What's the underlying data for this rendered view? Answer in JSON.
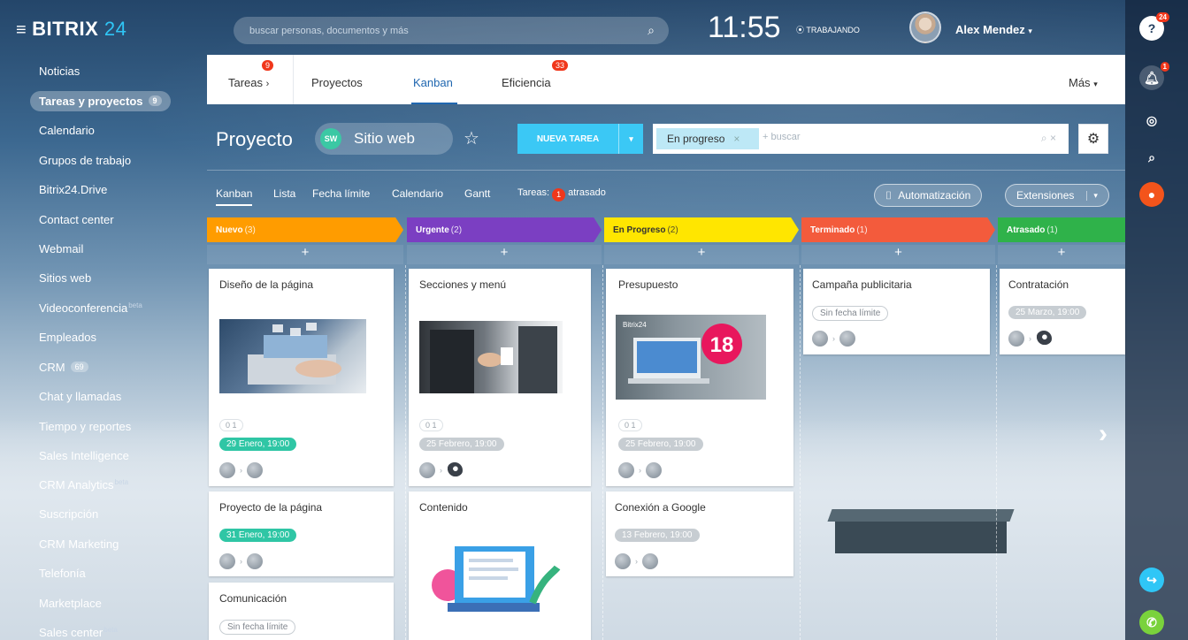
{
  "topbar": {
    "logo_main": "BITRIX",
    "logo_24": " 24",
    "search_placeholder": "buscar personas, documentos y más",
    "clock": "11:55",
    "work_status": "⦿ TRABAJANDO",
    "user_name": "Alex Mendez"
  },
  "right_panel": {
    "help_badge": "24",
    "notifications_badge": "1"
  },
  "sidebar": {
    "items": [
      {
        "label": "Noticias"
      },
      {
        "label": "Tareas y proyectos",
        "count": "9"
      },
      {
        "label": "Calendario"
      },
      {
        "label": "Grupos de trabajo"
      },
      {
        "label": "Bitrix24.Drive"
      },
      {
        "label": "Contact center"
      },
      {
        "label": "Webmail"
      },
      {
        "label": "Sitios web"
      },
      {
        "label": "Videoconferencia",
        "beta": "beta"
      },
      {
        "label": "Empleados"
      },
      {
        "label": "CRM",
        "count": "69"
      },
      {
        "label": "Chat y llamadas"
      },
      {
        "label": "Tiempo y reportes"
      },
      {
        "label": "Sales Intelligence"
      },
      {
        "label": "CRM Analytics",
        "beta": "beta"
      },
      {
        "label": "Suscripción"
      },
      {
        "label": "CRM Marketing"
      },
      {
        "label": "Telefonía"
      },
      {
        "label": "Marketplace"
      },
      {
        "label": "Sales center",
        "beta": "beta"
      }
    ]
  },
  "tabs": {
    "tareas": "Tareas",
    "tareas_badge": "9",
    "proyectos": "Proyectos",
    "kanban": "Kanban",
    "eficiencia": "Eficiencia",
    "eficiencia_badge": "33",
    "mas": "Más"
  },
  "project": {
    "title": "Proyecto",
    "name": "Sitio web",
    "new_task": "NUEVA TAREA",
    "filter_chip": "En progreso",
    "filter_placeholder": "+ buscar"
  },
  "views": {
    "kanban": "Kanban",
    "lista": "Lista",
    "fecha": "Fecha límite",
    "calendario": "Calendario",
    "gantt": "Gantt",
    "tareas_label": "Tareas:",
    "overdue_count": "1",
    "overdue_label": "atrasado",
    "automation": "Automatización",
    "extensions": "Extensiones"
  },
  "columns": [
    {
      "name": "Nuevo",
      "count": "(3)",
      "color": "#ff9c00"
    },
    {
      "name": "Urgente",
      "count": "(2)",
      "color": "#7b3fc2"
    },
    {
      "name": "En Progreso",
      "count": "(2)",
      "color": "#ffe600"
    },
    {
      "name": "Terminado",
      "count": "(1)",
      "color": "#f35b3c"
    },
    {
      "name": "Atrasado",
      "count": "(1)",
      "color": "#2fb24a"
    }
  ],
  "cards": {
    "c1": {
      "title": "Diseño de la página",
      "checklist": "0 1",
      "deadline": "29 Enero, 19:00"
    },
    "c2": {
      "title": "Proyecto de la página",
      "deadline": "31 Enero, 19:00"
    },
    "c3": {
      "title": "Comunicación",
      "deadline": "Sin fecha límite"
    },
    "c4": {
      "title": "Secciones y menú",
      "checklist": "0 1",
      "deadline": "25 Febrero, 19:00"
    },
    "c5": {
      "title": "Contenido"
    },
    "c6": {
      "title": "Presupuesto",
      "checklist": "0 1",
      "deadline": "25 Febrero, 19:00",
      "thumb_brand": "Bitrix24",
      "thumb_number": "18"
    },
    "c7": {
      "title": "Conexión a Google",
      "deadline": "13 Febrero, 19:00"
    },
    "c8": {
      "title": "Campaña publicitaria",
      "deadline": "Sin fecha límite"
    },
    "c9": {
      "title": "Contratación",
      "deadline": "25 Marzo, 19:00"
    }
  }
}
